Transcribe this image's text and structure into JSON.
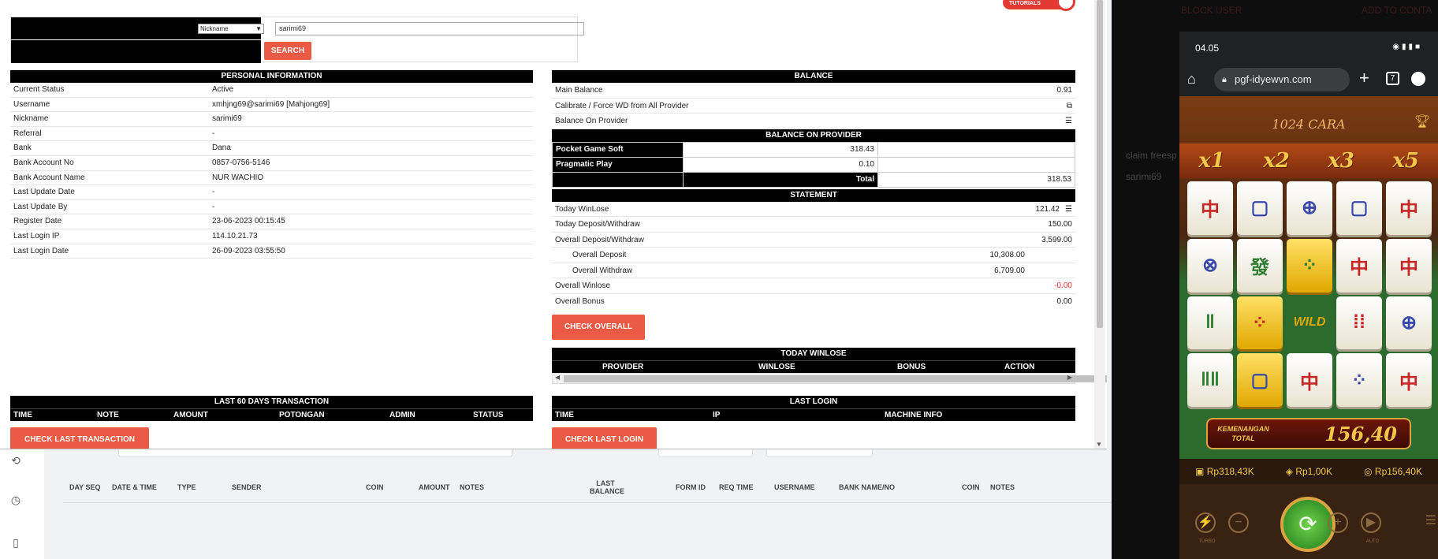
{
  "search": {
    "select_value": "Nickname",
    "input_value": "sarimi69",
    "button": "SEARCH"
  },
  "tutorials_label": "TUTORIALS",
  "personal": {
    "title": "PERSONAL INFORMATION",
    "rows": [
      {
        "k": "Current Status",
        "v": "Active"
      },
      {
        "k": "Username",
        "v": "xmhjng69@sarimi69  [Mahjong69]"
      },
      {
        "k": "Nickname",
        "v": "sarimi69"
      },
      {
        "k": "Referral",
        "v": "-"
      },
      {
        "k": "Bank",
        "v": "Dana"
      },
      {
        "k": "Bank Account No",
        "v": "0857-0756-5146"
      },
      {
        "k": "Bank Account Name",
        "v": "NUR WACHIO"
      },
      {
        "k": "Last Update Date",
        "v": "-"
      },
      {
        "k": "Last Update By",
        "v": "-"
      },
      {
        "k": "Register Date",
        "v": "23-06-2023 00:15:45"
      },
      {
        "k": "Last Login IP",
        "v": "114.10.21.73"
      },
      {
        "k": "Last Login Date",
        "v": "26-09-2023 03:55:50"
      }
    ]
  },
  "balance": {
    "title": "BALANCE",
    "main_label": "Main Balance",
    "main_value": "0.91",
    "calibrate_label": "Calibrate / Force WD from All Provider",
    "on_provider_label": "Balance On Provider"
  },
  "provider": {
    "title": "BALANCE ON PROVIDER",
    "rows": [
      {
        "name": "Pocket Game Soft",
        "value": "318.43"
      },
      {
        "name": "Pragmatic Play",
        "value": "0.10"
      }
    ],
    "total_label": "Total",
    "total_value": "318.53"
  },
  "statement": {
    "title": "STATEMENT",
    "today_winlose_label": "Today WinLose",
    "today_winlose": "121.42",
    "today_dw_label": "Today Deposit/Withdraw",
    "today_dw": "150.00",
    "overall_dw_label": "Overall Deposit/Withdraw",
    "overall_dw": "3,599.00",
    "overall_deposit_label": "Overall Deposit",
    "overall_deposit": "10,308.00",
    "overall_withdraw_label": "Overall Withdraw",
    "overall_withdraw": "6,709.00",
    "overall_winlose_label": "Overall Winlose",
    "overall_winlose": "-0.00",
    "overall_bonus_label": "Overall Bonus",
    "overall_bonus": "0.00",
    "check_button": "CHECK OVERALL"
  },
  "today_winlose": {
    "title": "TODAY WINLOSE",
    "cols": [
      "PROVIDER",
      "WINLOSE",
      "BONUS",
      "ACTION"
    ]
  },
  "last60": {
    "title": "LAST 60 DAYS TRANSACTION",
    "cols": [
      "TIME",
      "NOTE",
      "AMOUNT",
      "POTONGAN",
      "ADMIN",
      "STATUS"
    ],
    "button": "CHECK LAST TRANSACTION"
  },
  "last_login": {
    "title": "LAST LOGIN",
    "cols": [
      "TIME",
      "IP",
      "MACHINE INFO"
    ],
    "button": "CHECK LAST LOGIN"
  },
  "background_table": {
    "cols": [
      "DAY SEQ",
      "DATE & TIME",
      "TYPE",
      "SENDER",
      "COIN",
      "AMOUNT",
      "NOTES",
      "LAST BALANCE",
      "FORM ID",
      "REQ TIME",
      "USERNAME",
      "BANK NAME/NO",
      "COIN",
      "NOTES"
    ]
  },
  "right_bg": {
    "block_user": "BLOCK USER",
    "add_contact": "ADD TO CONTA",
    "claim": "claim freesp",
    "user": "sarimi69"
  },
  "phone": {
    "time": "04.05",
    "url": "pgf-idyewvn.com",
    "tab_count": "7",
    "cara": "1024 CARA",
    "multipliers": [
      "x1",
      "x2",
      "x3",
      "x5"
    ],
    "win_label": "KEMENANGAN TOTAL",
    "win_value": "156,40",
    "stats": [
      "Rp318,43K",
      "Rp1,00K",
      "Rp156,40K"
    ],
    "turbo": "TURBO",
    "auto": "AUTO"
  }
}
